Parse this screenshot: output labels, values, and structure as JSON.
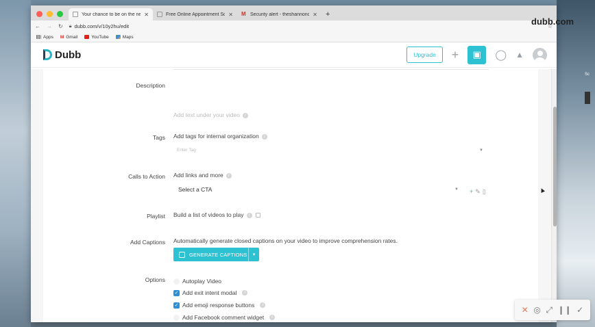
{
  "browser": {
    "tabs": [
      {
        "title": "Your chance to be on the next",
        "active": true
      },
      {
        "title": "Free Online Appointment Sche",
        "active": false
      },
      {
        "title": "Security alert - theshannonch",
        "active": false
      }
    ],
    "url": "dubb.com/v/10y2hu/edit",
    "bookmarks": [
      "Apps",
      "Gmail",
      "YouTube",
      "Maps"
    ]
  },
  "watermark": "dubb.com",
  "app": {
    "logo_text": "Dubb",
    "upgrade_label": "Upgrade"
  },
  "form": {
    "description": {
      "label": "Description",
      "placeholder": "Add text under your video"
    },
    "tags": {
      "label": "Tags",
      "hint": "Add tags for internal organization",
      "placeholder": "Enter Tag"
    },
    "cta": {
      "label": "Calls to Action",
      "hint": "Add links and more",
      "selected": "Select a CTA"
    },
    "playlist": {
      "label": "Playlist",
      "hint": "Build a list of videos to play"
    },
    "captions": {
      "label": "Add Captions",
      "hint": "Automatically generate closed captions on your video to improve comprehension rates.",
      "button_label": "GENERATE CAPTIONS"
    },
    "options": {
      "label": "Options",
      "items": [
        {
          "label": "Autoplay Video",
          "checked": false
        },
        {
          "label": "Add exit intent modal",
          "checked": true
        },
        {
          "label": "Add emoji response buttons",
          "checked": true
        },
        {
          "label": "Add Facebook comment widget",
          "checked": false
        }
      ]
    }
  },
  "colors": {
    "accent": "#2ec1d2",
    "checkbox": "#2d8fd5"
  }
}
